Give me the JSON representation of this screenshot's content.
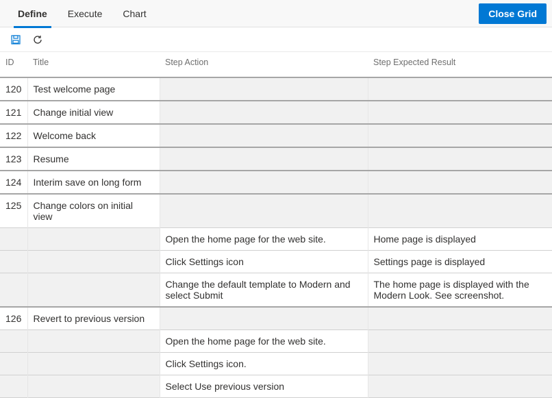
{
  "tabs": {
    "define": "Define",
    "execute": "Execute",
    "chart": "Chart"
  },
  "buttons": {
    "close": "Close Grid"
  },
  "headers": {
    "id": "ID",
    "title": "Title",
    "action": "Step Action",
    "expected": "Step Expected Result"
  },
  "rows": [
    {
      "id": "120",
      "title": "Test welcome page",
      "action": "",
      "expected": "",
      "shadeAction": true,
      "shadeExpected": true,
      "top": true
    },
    {
      "id": "121",
      "title": "Change initial view",
      "action": "",
      "expected": "",
      "shadeAction": true,
      "shadeExpected": true,
      "top": true
    },
    {
      "id": "122",
      "title": "Welcome back",
      "action": "",
      "expected": "",
      "shadeAction": true,
      "shadeExpected": true,
      "top": true
    },
    {
      "id": "123",
      "title": "Resume",
      "action": "",
      "expected": "",
      "shadeAction": true,
      "shadeExpected": true,
      "top": true
    },
    {
      "id": "124",
      "title": "Interim save on long form",
      "action": "",
      "expected": "",
      "shadeAction": true,
      "shadeExpected": true,
      "top": true
    },
    {
      "id": "125",
      "title": "Change colors on initial view",
      "action": "",
      "expected": "",
      "shadeAction": true,
      "shadeExpected": true,
      "top": true
    },
    {
      "id": "",
      "title": "",
      "action": "Open the home page for the web site.",
      "expected": "Home page is displayed",
      "shadeId": true,
      "shadeTitle": true
    },
    {
      "id": "",
      "title": "",
      "action": "Click Settings icon",
      "expected": "Settings page is displayed",
      "shadeId": true,
      "shadeTitle": true
    },
    {
      "id": "",
      "title": "",
      "action": "Change the default template to Modern and select Submit",
      "expected": "The home page is displayed with the Modern Look. See screenshot.",
      "shadeId": true,
      "shadeTitle": true
    },
    {
      "id": "126",
      "title": "Revert to previous version",
      "action": "",
      "expected": "",
      "shadeAction": true,
      "shadeExpected": true,
      "top": true
    },
    {
      "id": "",
      "title": "",
      "action": "Open the home page for the web site.",
      "expected": "",
      "shadeId": true,
      "shadeTitle": true,
      "shadeExpected": true
    },
    {
      "id": "",
      "title": "",
      "action": "Click Settings icon.",
      "expected": "",
      "shadeId": true,
      "shadeTitle": true,
      "shadeExpected": true
    },
    {
      "id": "",
      "title": "",
      "action": "Select Use previous version",
      "expected": "",
      "shadeId": true,
      "shadeTitle": true,
      "shadeExpected": true
    }
  ]
}
